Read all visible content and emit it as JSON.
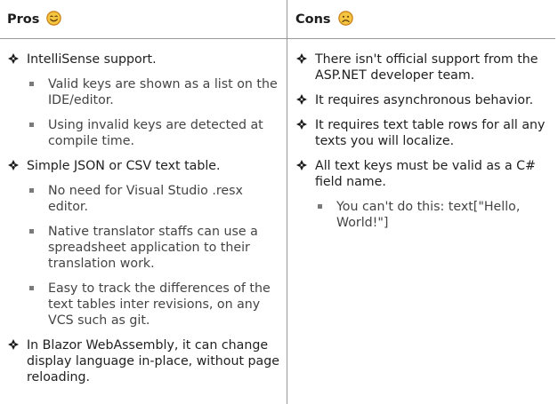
{
  "header": {
    "pros_label": "Pros",
    "cons_label": "Cons",
    "pros_icon": "smiling-face-icon",
    "cons_icon": "frowning-face-icon"
  },
  "pros": [
    {
      "text": "IntelliSense support.",
      "sub": [
        "Valid keys are shown as a list on the IDE/editor.",
        "Using invalid keys are detected at compile time."
      ]
    },
    {
      "text": "Simple JSON or CSV text table.",
      "sub": [
        "No need for Visual Studio .resx editor.",
        "Native translator staffs can use a spreadsheet application to their translation work.",
        "Easy to track the differences of the text tables inter revisions, on any VCS such as git."
      ]
    },
    {
      "text": "In Blazor WebAssembly, it can change display language in-place, without page reloading.",
      "sub": []
    }
  ],
  "cons": [
    {
      "text": "There isn't official support from the ASP.NET developer team.",
      "sub": []
    },
    {
      "text": "It requires asynchronous behavior.",
      "sub": []
    },
    {
      "text": "It requires text table rows for all any texts you will localize.",
      "sub": []
    },
    {
      "text": "All text keys must be valid as a C# field name.",
      "sub": [
        "You can't do this: text[\"Hello, World!\"]"
      ]
    }
  ],
  "colors": {
    "divider": "#9a9a9a",
    "emoji_fill": "#f5c542",
    "emoji_outline": "#c77d12"
  }
}
